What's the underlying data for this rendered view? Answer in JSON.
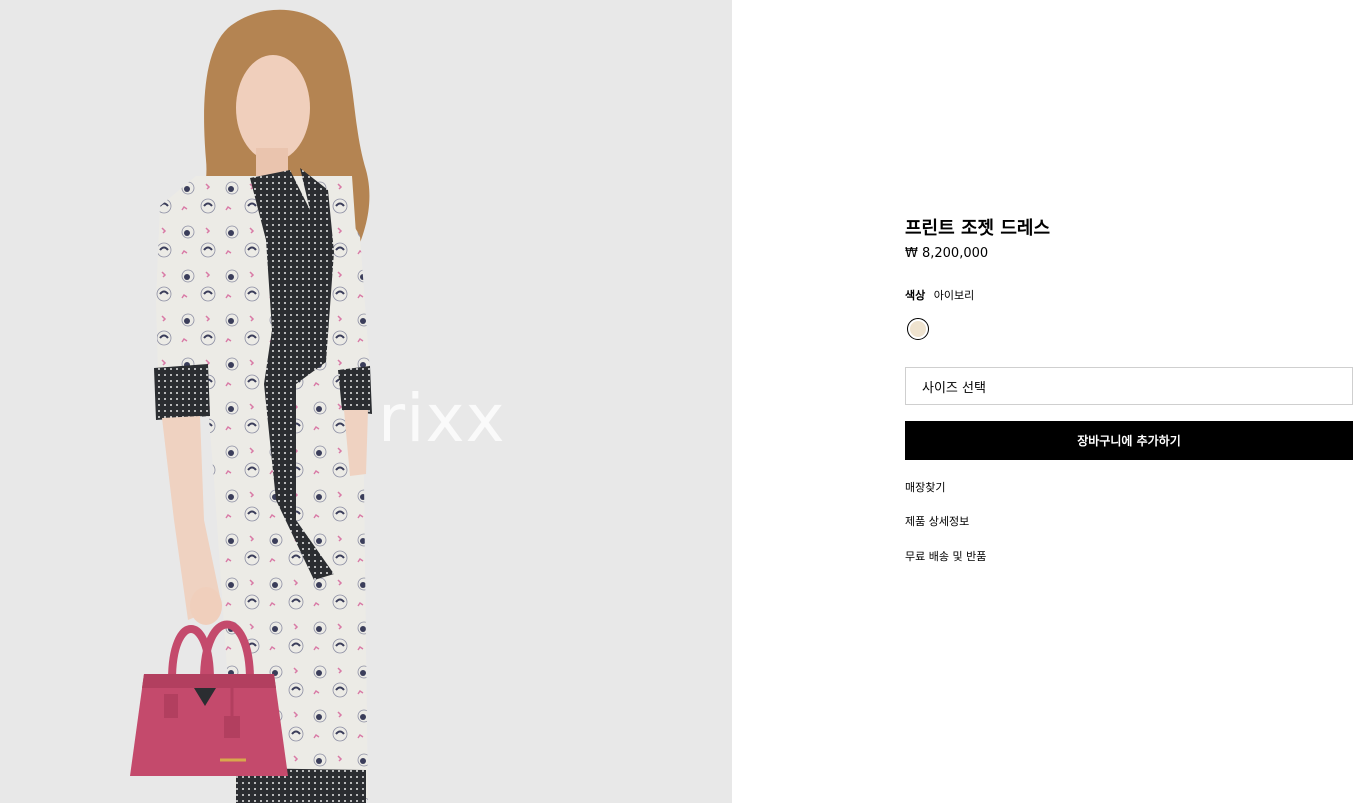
{
  "product": {
    "title": "프린트 조젯 드레스",
    "price": "₩ 8,200,000",
    "color_label": "색상",
    "color_value": "아이보리",
    "swatch_color": "#efe3cf"
  },
  "size_select": {
    "placeholder": "사이즈 선택"
  },
  "cart_button": {
    "label": "장바구니에 추가하기"
  },
  "links": {
    "store_finder": "매장찾기",
    "product_details": "제품 상세정보",
    "shipping_returns": "무료 배송 및 반품"
  },
  "watermark": {
    "text": "rixx",
    "tail": "xx"
  },
  "photo": {
    "background": "#eaeaea",
    "dress_color": "#ecebe6",
    "scarf_color": "#2b2d31",
    "bag_color": "#c44a6c",
    "hair_color": "#b48452"
  }
}
